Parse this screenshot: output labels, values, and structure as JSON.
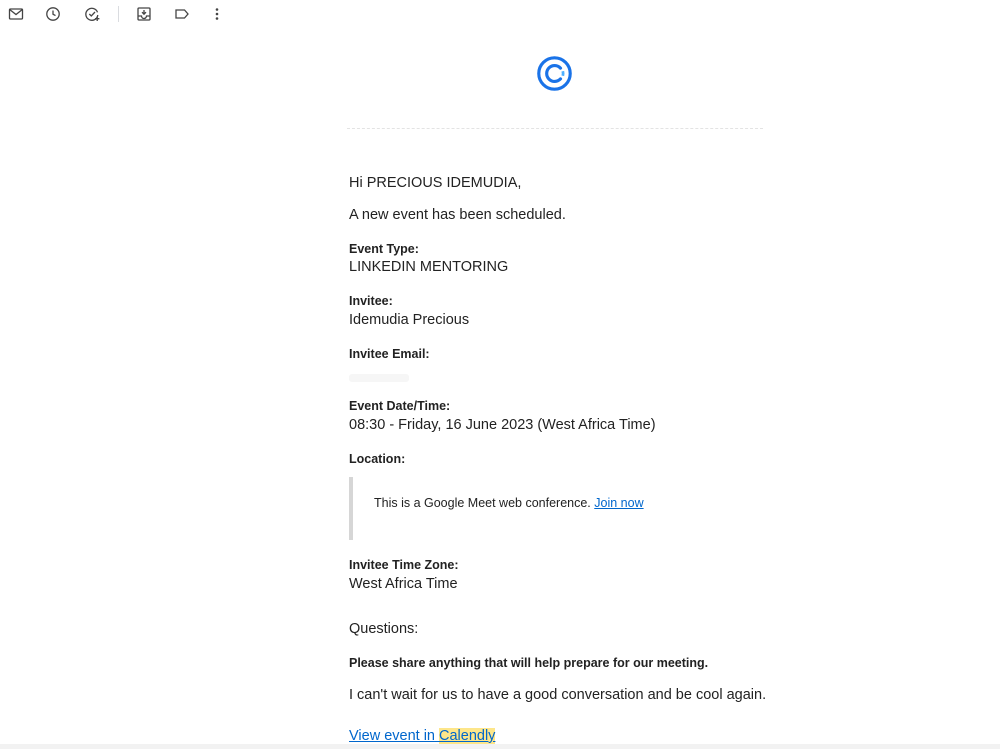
{
  "toolbar": {
    "icons": [
      "mail-icon",
      "clock-icon",
      "add-task-icon",
      "move-to-inbox-icon",
      "label-icon",
      "more-vert-icon"
    ]
  },
  "email": {
    "greeting": "Hi PRECIOUS IDEMUDIA,",
    "intro": "A new event has been scheduled.",
    "event_type_label": "Event Type:",
    "event_type_value": "LINKEDIN MENTORING",
    "invitee_label": "Invitee:",
    "invitee_value": "Idemudia Precious",
    "invitee_email_label": "Invitee Email:",
    "invitee_email_value": "",
    "date_label": "Event Date/Time:",
    "date_value": "08:30 - Friday, 16 June 2023 (West Africa Time)",
    "location_label": "Location:",
    "location_text": "This is a Google Meet web conference.",
    "join_link": "Join now",
    "tz_label": "Invitee Time Zone:",
    "tz_value": "West Africa Time",
    "questions_label": "Questions:",
    "question": "Please share anything that will help prepare for our meeting.",
    "answer": "I can't wait for us to have a good conversation and be cool again.",
    "view_link_prefix": "View event in",
    "view_link_brand": "Calendly"
  },
  "colors": {
    "link": "#0066cc",
    "brand_blue": "#1a73e8",
    "highlight": "#fde68a"
  }
}
